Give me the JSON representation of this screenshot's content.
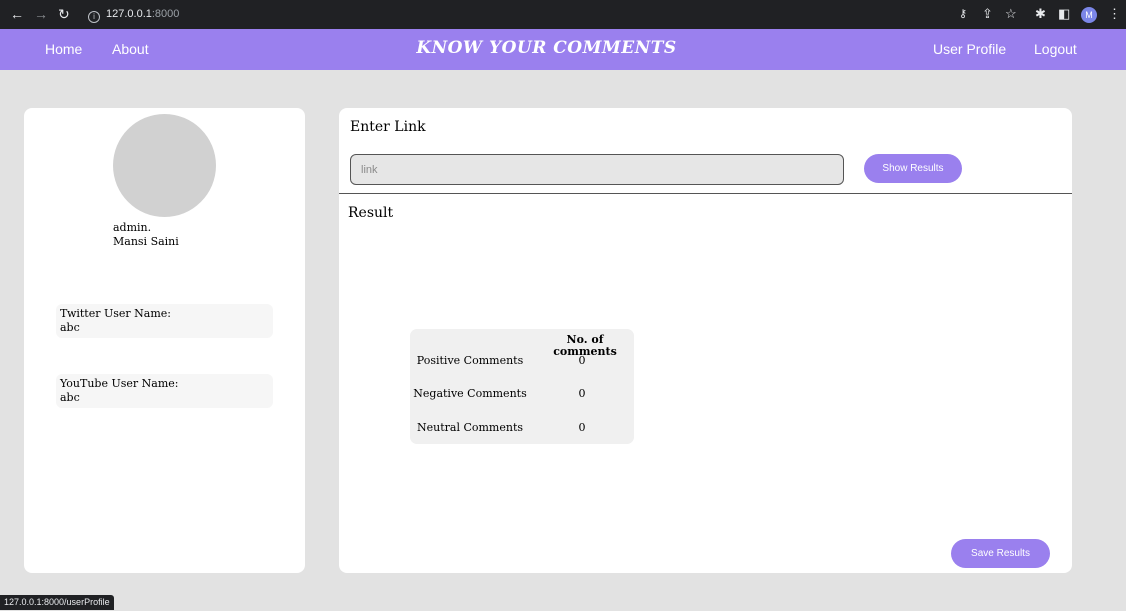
{
  "browser": {
    "address": "127.0.0.1",
    "port": ":8000",
    "status_url": "127.0.0.1:8000/userProfile",
    "profile_initial": "M",
    "icons": [
      "back-icon",
      "forward-icon",
      "reload-icon",
      "info-icon",
      "key-icon",
      "share-icon",
      "star-icon",
      "extensions-icon",
      "sidebar-icon",
      "menu-icon"
    ]
  },
  "nav": {
    "home": "Home",
    "about": "About",
    "brand": "KNOW YOUR COMMENTS",
    "user_profile": "User Profile",
    "logout": "Logout"
  },
  "profile": {
    "username": "admin.",
    "fullname": "Mansi Saini",
    "twitter_label": "Twitter User Name:",
    "twitter_value": "abc",
    "youtube_label": "YouTube User Name:",
    "youtube_value": "abc"
  },
  "main": {
    "enter_link_title": "Enter Link",
    "link_placeholder": "link",
    "link_value": "",
    "show_results_label": "Show Results",
    "result_title": "Result",
    "table_header": "No. of comments",
    "rows": [
      {
        "label": "Positive Comments",
        "value": "0"
      },
      {
        "label": "Negative Comments",
        "value": "0"
      },
      {
        "label": "Neutral Comments",
        "value": "0"
      }
    ],
    "save_results_label": "Save Results"
  },
  "colors": {
    "accent": "#9a80ee",
    "page_bg": "#e2e2e2",
    "chrome_bg": "#202124"
  }
}
